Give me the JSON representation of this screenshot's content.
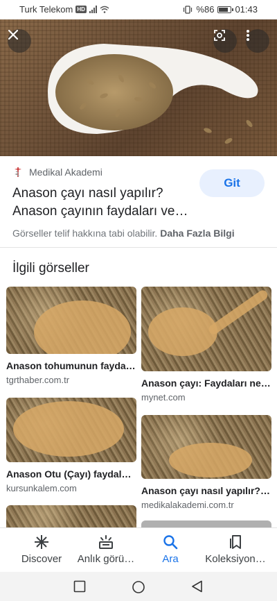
{
  "status_bar": {
    "carrier": "Turk Telekom",
    "network_badge": "HD",
    "battery_text": "%86",
    "battery_level": 0.86,
    "time": "01:43"
  },
  "hero": {
    "close_icon": "close-icon",
    "lens_icon": "lens-icon",
    "more_icon": "more-vert-icon"
  },
  "result": {
    "source": "Medikal Akademi",
    "title_line1": "Anason çayı nasıl yapılır?",
    "title_line2": "Anason çayının faydaları ve…",
    "visit_label": "Git",
    "copyright_text": "Görseller telif hakkına tabi olabilir.",
    "more_info_label": "Daha Fazla Bilgi"
  },
  "related": {
    "heading": "İlgili görseller",
    "items": [
      {
        "title": "Anason tohumunun fayda…",
        "domain": "tgrthaber.com.tr"
      },
      {
        "title": "Anason çayı: Faydaları ne…",
        "domain": "mynet.com"
      },
      {
        "title": "Anason Otu (Çayı) faydal…",
        "domain": "kursunkalem.com"
      },
      {
        "title": "Anason çayı nasıl yapılır?…",
        "domain": "medikalakademi.com.tr"
      }
    ]
  },
  "bottom_nav": {
    "items": [
      {
        "label": "Discover",
        "icon": "asterisk-icon"
      },
      {
        "label": "Anlık görü…",
        "icon": "updates-icon"
      },
      {
        "label": "Ara",
        "icon": "search-icon"
      },
      {
        "label": "Koleksiyon…",
        "icon": "collections-icon"
      }
    ],
    "active_color": "#1a73e8"
  },
  "colors": {
    "accent": "#1a73e8",
    "git_bg": "#e8f0fe"
  }
}
